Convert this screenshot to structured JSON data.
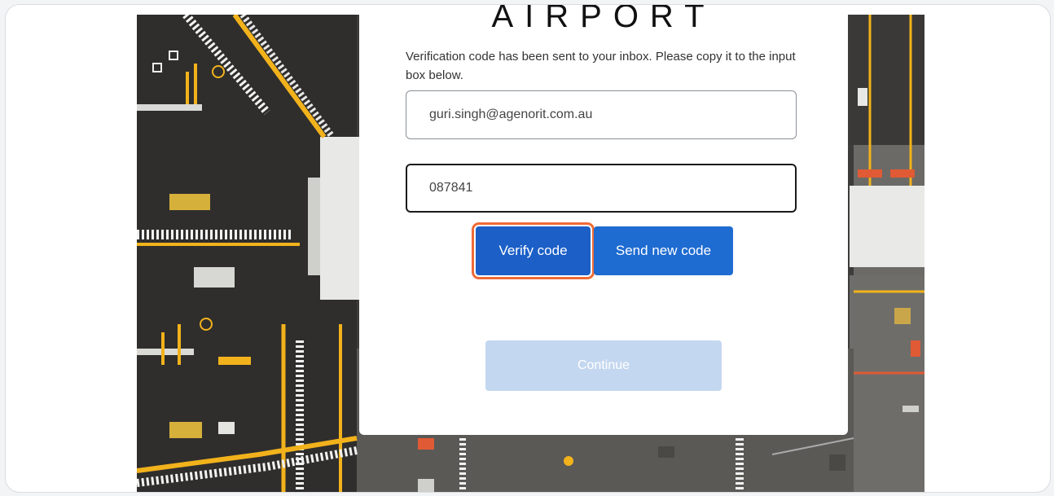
{
  "logo": {
    "text": "AIRPORT"
  },
  "message": "Verification code has been sent to your inbox. Please copy it to the input box below.",
  "email_field": {
    "value": "guri.singh@agenorit.com.au"
  },
  "code_field": {
    "value": "087841"
  },
  "buttons": {
    "verify": "Verify code",
    "send_new": "Send new code",
    "continue": "Continue"
  },
  "colors": {
    "primary": "#1b5fc7",
    "highlight": "#f06a36",
    "disabled": "#c4d7f0"
  }
}
